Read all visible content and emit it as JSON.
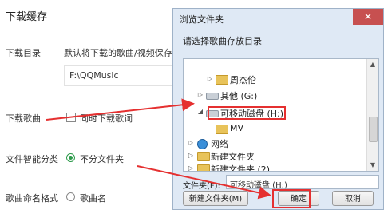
{
  "settings": {
    "section_title": "下载缓存",
    "download_dir_label": "下载目录",
    "download_dir_desc": "默认将下载的歌曲/视频保存",
    "download_dir_path": "F:\\QQMusic",
    "download_songs_label": "下载歌曲",
    "download_songs_option": "同时下载歌词",
    "smart_category_label": "文件智能分类",
    "smart_category_option": "不分文件夹",
    "naming_label": "歌曲命名格式",
    "naming_option": "歌曲名"
  },
  "dialog": {
    "title": "浏览文件夹",
    "close_glyph": "✕",
    "prompt": "请选择歌曲存放目录",
    "tree_items": [
      {
        "label": "周杰伦"
      },
      {
        "label": "其他 (G:)"
      },
      {
        "label": "可移动磁盘 (H:)"
      },
      {
        "label": "MV"
      },
      {
        "label": "网络"
      },
      {
        "label": "新建文件夹"
      },
      {
        "label": "新建文件夹 (2)"
      }
    ],
    "folder_field_label": "文件夹(F):",
    "folder_field_value": "可移动磁盘 (H:)",
    "new_folder_button": "新建文件夹(M)",
    "ok_button": "确定",
    "cancel_button": "取消"
  },
  "colors": {
    "annotation_red": "#e53030",
    "radio_selected": "#2c9a4a",
    "dialog_bg": "#dfe9f5"
  }
}
